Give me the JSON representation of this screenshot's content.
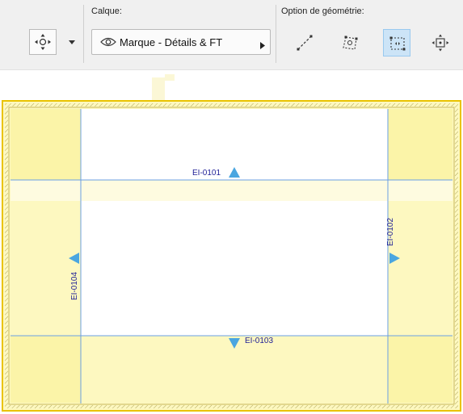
{
  "toolbar": {
    "layer_label": "Calque:",
    "layer_value": "Marque - Détails & FT",
    "geometry_label": "Option de géométrie:",
    "geometry_options": [
      {
        "icon": "line-method-icon",
        "selected": false
      },
      {
        "icon": "rotated-rectangle-method-icon",
        "selected": false
      },
      {
        "icon": "rectangle-method-icon",
        "selected": true
      },
      {
        "icon": "center-expand-method-icon",
        "selected": false
      }
    ]
  },
  "drawing": {
    "elevation_markers": [
      {
        "id": "EI-0101",
        "label": "EI-0101"
      },
      {
        "id": "EI-0102",
        "label": "EI-0102"
      },
      {
        "id": "EI-0103",
        "label": "EI-0103"
      },
      {
        "id": "EI-0104",
        "label": "EI-0104"
      }
    ],
    "colors": {
      "wall_fill": "#fdf8c0",
      "wall_outline": "#e9c300",
      "selection_lines": "#6a9fe3",
      "marker": "#4aa6e0",
      "marker_text": "#1e1e96"
    }
  }
}
